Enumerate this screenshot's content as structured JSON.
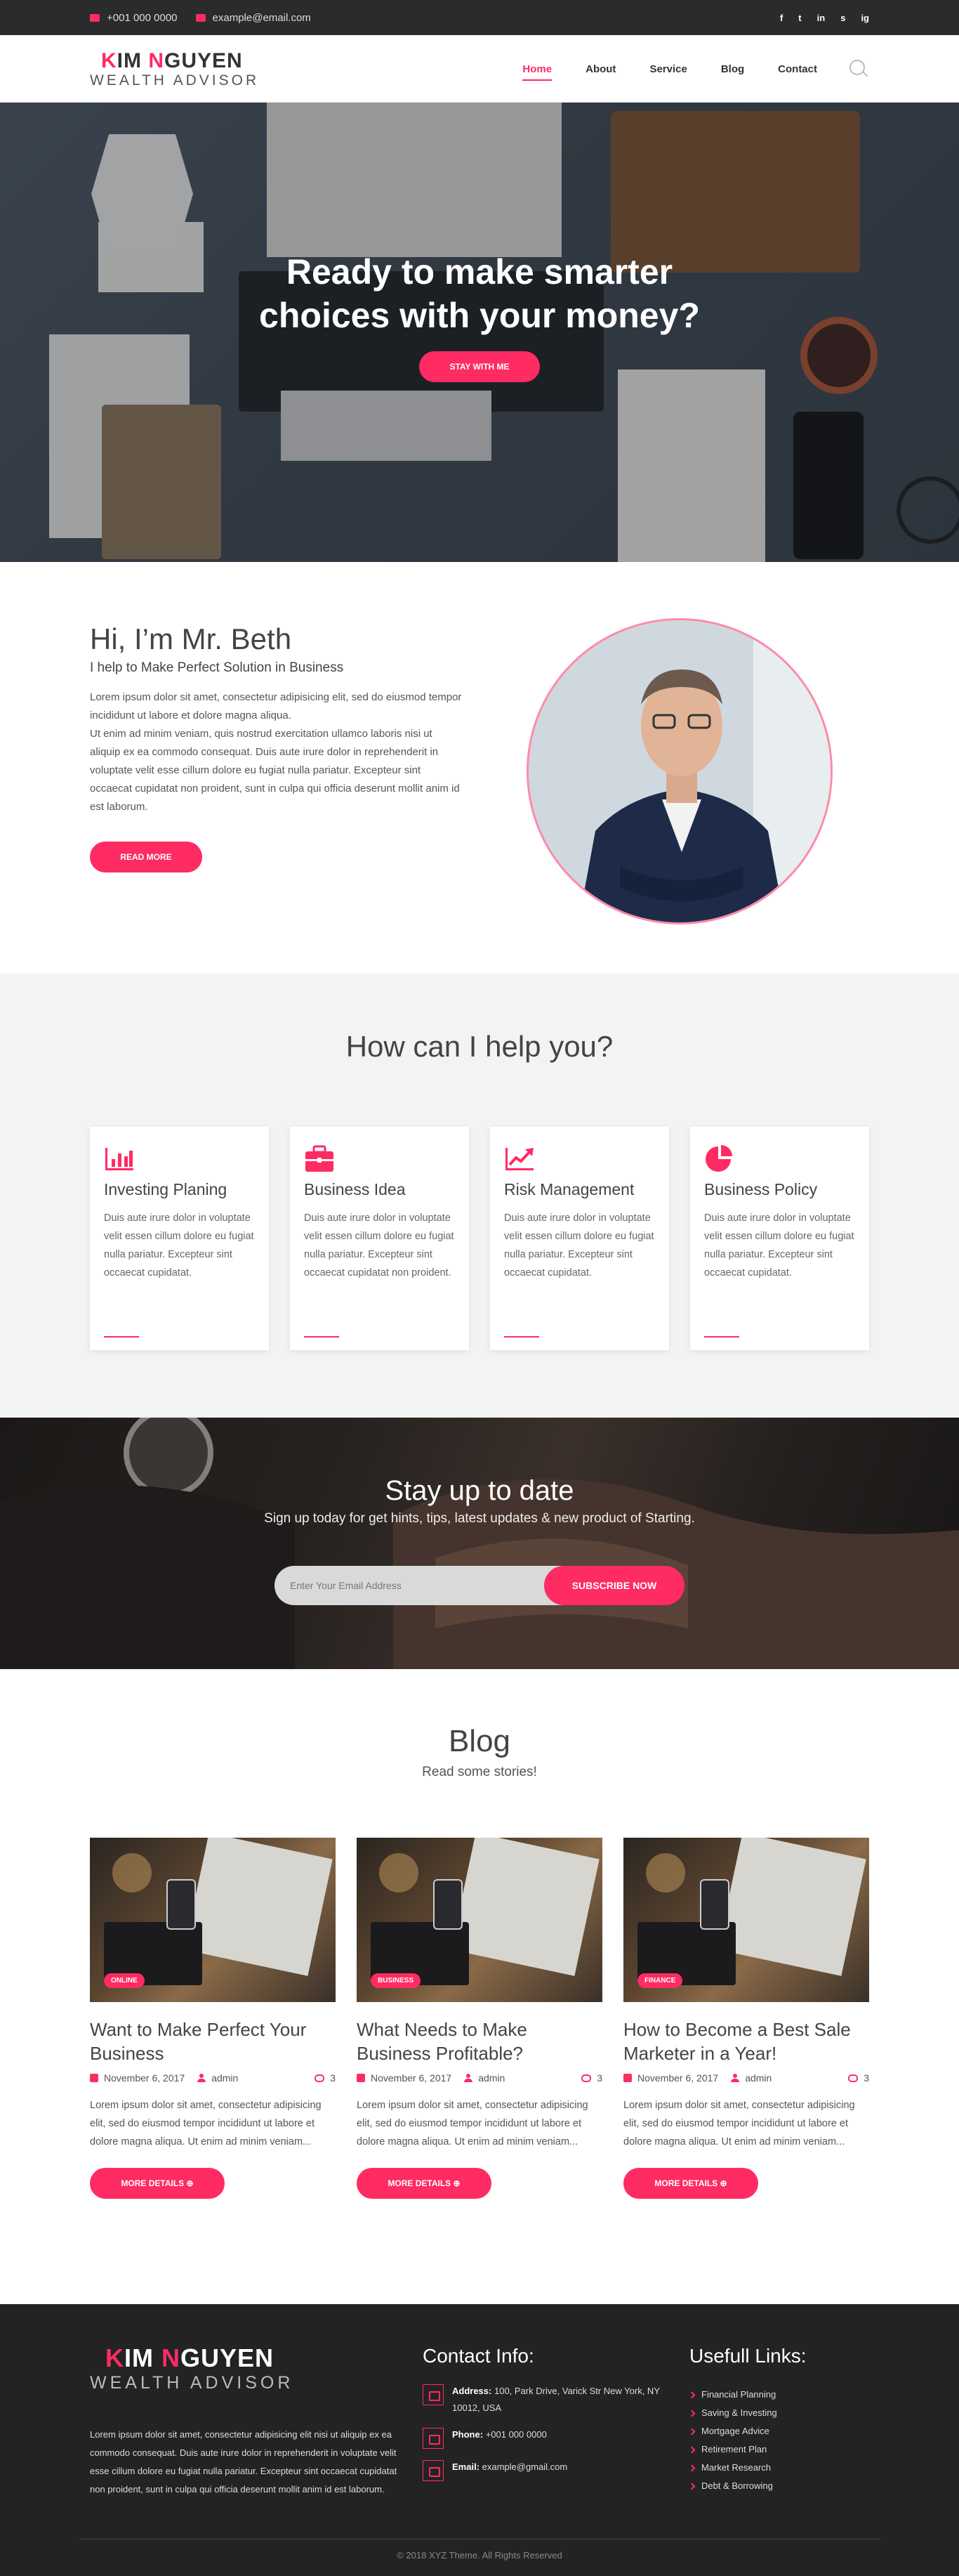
{
  "topbar": {
    "phone": "+001 000 0000",
    "email": "example@email.com",
    "socials": [
      "f",
      "t",
      "in",
      "s",
      "ig"
    ]
  },
  "header": {
    "logo_line1_first": "K",
    "logo_line1_mid": "IM ",
    "logo_line1_accent": "N",
    "logo_line1_rest": "GUYEN",
    "logo_line2": "WEALTH ADVISOR",
    "nav": [
      "Home",
      "About",
      "Service",
      "Blog",
      "Contact"
    ]
  },
  "hero": {
    "title_line1": "Ready to make smarter",
    "title_line2": "choices with your money?",
    "button": "STAY WITH ME"
  },
  "about": {
    "title": "Hi, I’m Mr. Beth",
    "subtitle": "I help to Make Perfect Solution in Business",
    "body1": "Lorem ipsum dolor sit amet, consectetur adipisicing elit, sed do eiusmod tempor incididunt ut labore et dolore magna aliqua.",
    "body2": "Ut enim ad minim veniam, quis nostrud exercitation ullamco laboris nisi ut aliquip ex ea commodo consequat. Duis aute irure dolor in reprehenderit in voluptate velit esse cillum dolore eu fugiat nulla pariatur. Excepteur sint occaecat cupidatat non proident, sunt in culpa qui officia deserunt mollit anim id est laborum.",
    "button": "READ MORE"
  },
  "services": {
    "title": "How can I help you?",
    "cards": [
      {
        "icon": "bar-chart-icon",
        "title": "Investing Planing",
        "text": "Duis aute irure dolor in voluptate velit essen cillum dolore eu fugiat nulla pariatur. Excepteur sint occaecat cupidatat."
      },
      {
        "icon": "briefcase-icon",
        "title": "Business Idea",
        "text": "Duis aute irure dolor in voluptate velit essen cillum dolore eu fugiat nulla pariatur. Excepteur sint occaecat cupidatat non proident."
      },
      {
        "icon": "trend-chart-icon",
        "title": "Risk Management",
        "text": "Duis aute irure dolor in voluptate velit essen cillum dolore eu fugiat nulla pariatur. Excepteur sint occaecat cupidatat."
      },
      {
        "icon": "pie-chart-icon",
        "title": "Business Policy",
        "text": "Duis aute irure dolor in voluptate velit essen cillum dolore eu fugiat nulla pariatur. Excepteur sint occaecat cupidatat."
      }
    ]
  },
  "newsletter": {
    "title": "Stay up to date",
    "subtitle": "Sign up today for get hints, tips, latest updates & new product of Starting.",
    "placeholder": "Enter Your Email Address",
    "button": "SUBSCRIBE NOW"
  },
  "blog": {
    "title": "Blog",
    "subtitle": "Read some stories!",
    "posts": [
      {
        "tag": "ONLINE",
        "title": "Want to Make Perfect Your Business",
        "date": "November 6, 2017",
        "author": "admin",
        "comments": "3",
        "excerpt": "Lorem ipsum dolor sit amet, consectetur adipisicing elit, sed do eiusmod tempor incididunt ut labore et dolore magna aliqua. Ut enim ad minim veniam...",
        "button": "MORE DETAILS"
      },
      {
        "tag": "BUSINESS",
        "title": "What Needs to Make Business Profitable?",
        "date": "November 6, 2017",
        "author": "admin",
        "comments": "3",
        "excerpt": "Lorem ipsum dolor sit amet, consectetur adipisicing elit, sed do eiusmod tempor incididunt ut labore et dolore magna aliqua. Ut enim ad minim veniam...",
        "button": "MORE DETAILS"
      },
      {
        "tag": "FINANCE",
        "title": "How to Become a Best Sale Marketer in a Year!",
        "date": "November 6, 2017",
        "author": "admin",
        "comments": "3",
        "excerpt": "Lorem ipsum dolor sit amet, consectetur adipisicing elit, sed do eiusmod tempor incididunt ut labore et dolore magna aliqua. Ut enim ad minim veniam...",
        "button": "MORE DETAILS"
      }
    ]
  },
  "footer": {
    "about": "Lorem ipsum dolor sit amet, consectetur adipisicing elit nisi ut aliquip ex ea commodo consequat. Duis aute irure dolor in reprehenderit in voluptate velit esse cillum dolore eu fugiat nulla pariatur. Excepteur sint occaecat cupidatat non proident, sunt in culpa qui officia deserunt mollit anim id est laborum.",
    "contact_title": "Contact Info:",
    "address_label": "Address:",
    "address": "100, Park Drive, Varick Str New York, NY 10012, USA",
    "phone_label": "Phone:",
    "phone": "+001 000 0000",
    "email_label": "Email:",
    "email": "example@gmail.com",
    "links_title": "Usefull Links:",
    "links": [
      "Financial Planning",
      "Saving & Investing",
      "Mortgage Advice",
      "Retirement Plan",
      "Market Research",
      "Debt & Borrowing"
    ],
    "copyright": "© 2018 XYZ Theme. All Rights Reserved"
  },
  "colors": {
    "accent": "#ff2b63",
    "dark": "#232323",
    "topbar": "#2b2b2b",
    "light_bg": "#f2f3f3"
  }
}
